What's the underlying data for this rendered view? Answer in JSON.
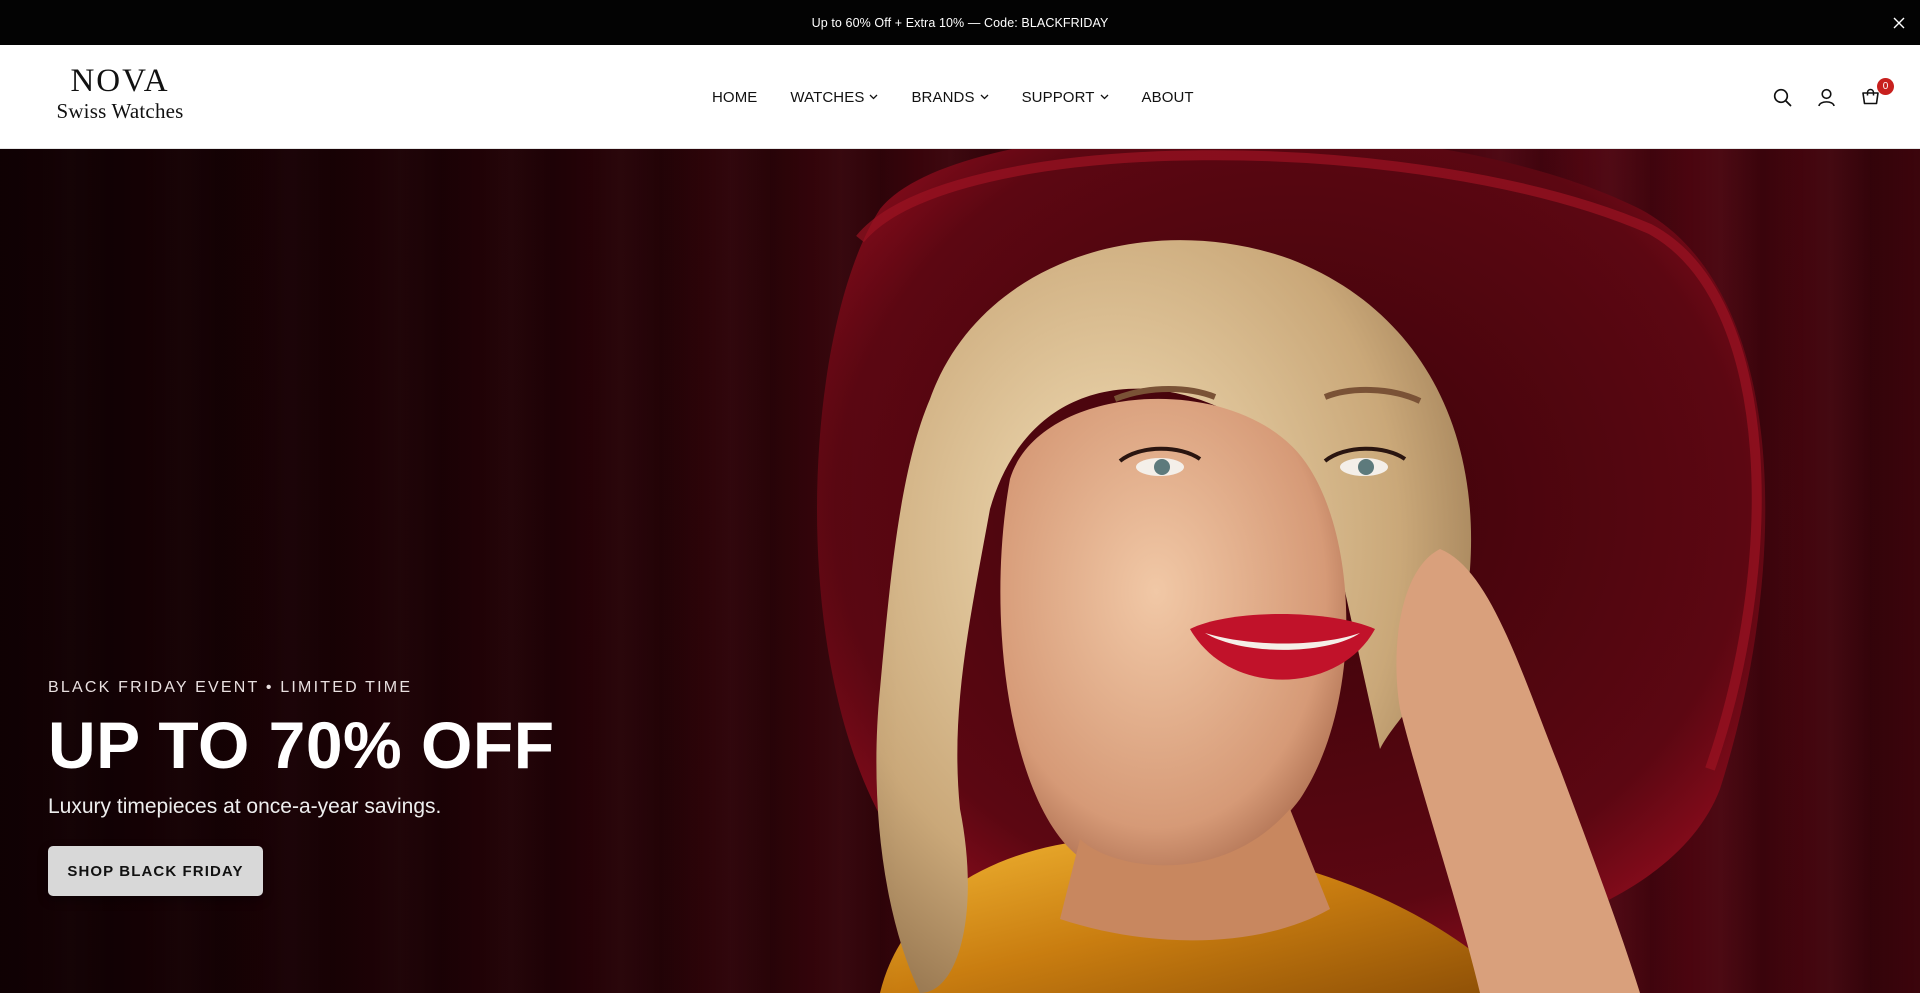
{
  "announcement": {
    "text": "Up to 60% Off + Extra 10% — Code: BLACKFRIDAY",
    "close_icon": "close-icon"
  },
  "header": {
    "logo": {
      "brand": "NOVA",
      "tagline": "Swiss Watches"
    },
    "nav": [
      {
        "label": "HOME",
        "has_dropdown": false
      },
      {
        "label": "WATCHES",
        "has_dropdown": true
      },
      {
        "label": "BRANDS",
        "has_dropdown": true
      },
      {
        "label": "SUPPORT",
        "has_dropdown": true
      },
      {
        "label": "ABOUT",
        "has_dropdown": false
      }
    ],
    "actions": {
      "search_icon": "search-icon",
      "account_icon": "user-icon",
      "cart_icon": "cart-icon",
      "cart_count": "0"
    }
  },
  "hero": {
    "eyebrow": "BLACK FRIDAY EVENT • LIMITED TIME",
    "headline": "UP TO 70% OFF",
    "subline": "Luxury timepieces at once-a-year savings.",
    "cta_label": "SHOP BLACK FRIDAY"
  },
  "colors": {
    "announcement_bg": "#030303",
    "hero_bg": "#4a0510",
    "cart_badge": "#c8201e",
    "cta_bg": "#d8d8d8"
  }
}
